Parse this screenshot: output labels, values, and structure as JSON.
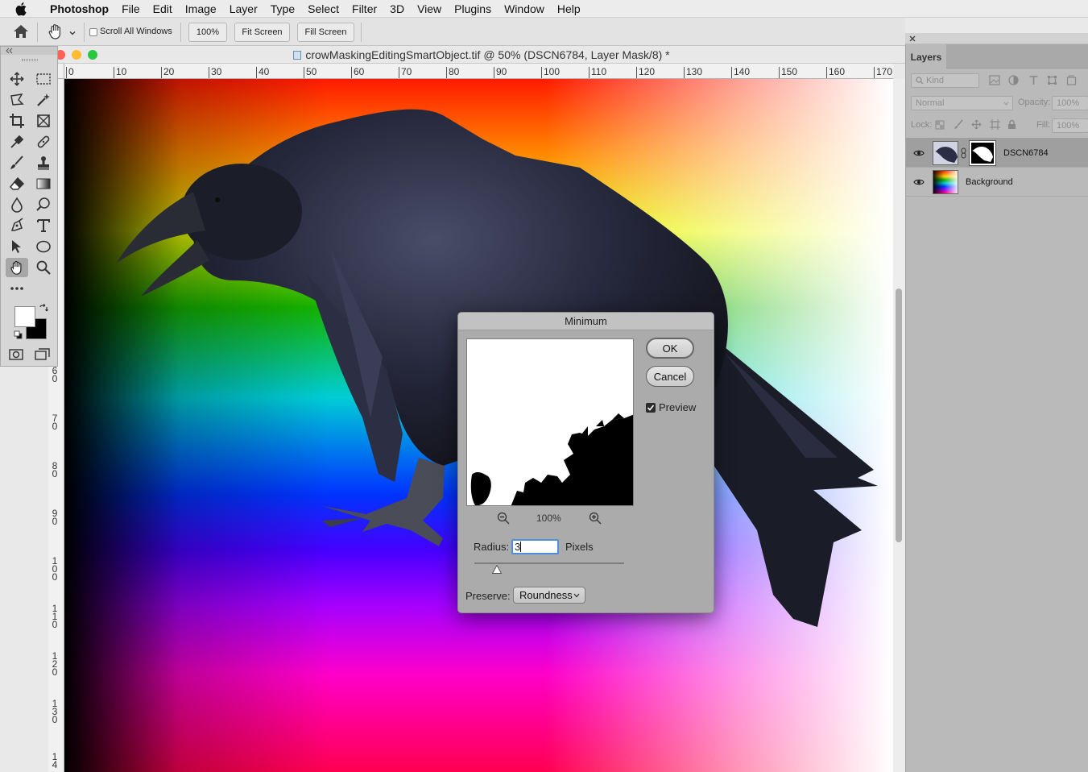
{
  "menubar": {
    "items": [
      "Photoshop",
      "File",
      "Edit",
      "Image",
      "Layer",
      "Type",
      "Select",
      "Filter",
      "3D",
      "View",
      "Plugins",
      "Window",
      "Help"
    ]
  },
  "options": {
    "scroll_all_windows": "Scroll All Windows",
    "zoom_100": "100%",
    "fit_screen": "Fit Screen",
    "fill_screen": "Fill Screen"
  },
  "document": {
    "title": "crowMaskingEditingSmartObject.tif @ 50% (DSCN6784, Layer Mask/8) *",
    "hruler_ticks": [
      "0",
      "10",
      "20",
      "30",
      "40",
      "50",
      "60",
      "70",
      "80",
      "90",
      "100",
      "110",
      "120",
      "130",
      "140",
      "150",
      "160",
      "170"
    ],
    "vruler_ticks": [
      "60",
      "70",
      "80",
      "90",
      "100",
      "110",
      "120",
      "130",
      "14"
    ]
  },
  "dialog": {
    "title": "Minimum",
    "ok": "OK",
    "cancel": "Cancel",
    "preview_label": "Preview",
    "preview_checked": true,
    "zoom": "100%",
    "radius_label": "Radius:",
    "radius_value": "3",
    "radius_units": "Pixels",
    "preserve_label": "Preserve:",
    "preserve_value": "Roundness"
  },
  "layers_panel": {
    "tab": "Layers",
    "filter_kind": "Kind",
    "blend_mode": "Normal",
    "opacity_label": "Opacity:",
    "opacity_value": "100%",
    "lock_label": "Lock:",
    "fill_label": "Fill:",
    "fill_value": "100%",
    "layers": [
      {
        "name": "DSCN6784",
        "selected": true,
        "has_mask": true
      },
      {
        "name": "Background",
        "selected": false,
        "has_mask": false
      }
    ]
  }
}
